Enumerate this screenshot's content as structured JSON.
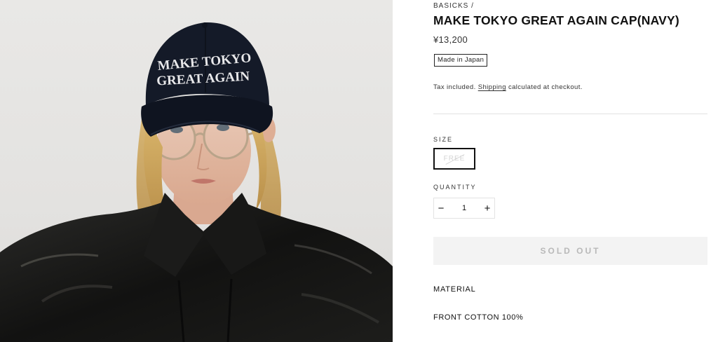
{
  "photo": {
    "cap_text_line1": "MAKE TOKYO",
    "cap_text_line2": "GREAT AGAIN"
  },
  "product": {
    "breadcrumb": "BASICKS /",
    "title": "MAKE TOKYO GREAT AGAIN CAP(NAVY)",
    "price": "¥13,200",
    "tag": "Made in Japan",
    "tax_before": "Tax included.",
    "tax_link": "Shipping",
    "tax_after": "calculated at checkout."
  },
  "options": {
    "size_label": "SIZE",
    "size_value": "FREE",
    "quantity_label": "QUANTITY",
    "quantity_value": "1",
    "minus_symbol": "−",
    "plus_symbol": "+"
  },
  "actions": {
    "sold_out_label": "SOLD OUT"
  },
  "details": {
    "material_heading": "MATERIAL",
    "material_value": "FRONT COTTON 100%"
  },
  "colors": {
    "sold_out_bg": "#f3f3f3",
    "sold_out_text": "#b9b9b9",
    "cap_navy": "#141a28"
  }
}
